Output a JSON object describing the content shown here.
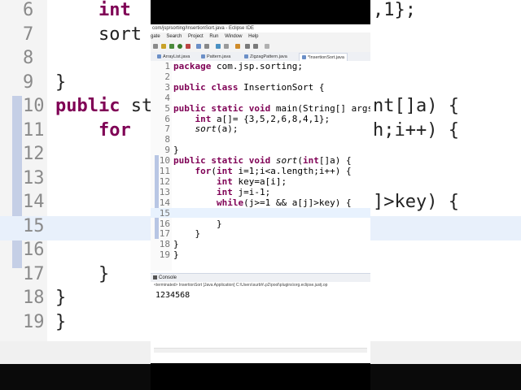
{
  "window": {
    "title": "com/jsp/sorting/InsertionSort.java - Eclipse IDE"
  },
  "menu": [
    "gate",
    "Search",
    "Project",
    "Run",
    "Window",
    "Help"
  ],
  "tabs": [
    {
      "label": "ArrayList.java",
      "active": false
    },
    {
      "label": "Pattern.java",
      "active": false
    },
    {
      "label": "ZigzagPattern.java",
      "active": false
    },
    {
      "label": "*InsertionSort.java",
      "active": true
    }
  ],
  "editor": {
    "lines": [
      {
        "n": "1",
        "code": "package com.jsp.sorting;"
      },
      {
        "n": "2",
        "code": ""
      },
      {
        "n": "3",
        "code": "public class InsertionSort {"
      },
      {
        "n": "4",
        "code": ""
      },
      {
        "n": "5",
        "code": "public static void main(String[] args"
      },
      {
        "n": "6",
        "code": "    int a[]= {3,5,2,6,8,4,1};"
      },
      {
        "n": "7",
        "code": "    sort(a);"
      },
      {
        "n": "8",
        "code": ""
      },
      {
        "n": "9",
        "code": "}"
      },
      {
        "n": "10",
        "code": "public static void sort(int[]a) {"
      },
      {
        "n": "11",
        "code": "    for(int i=1;i<a.length;i++) {"
      },
      {
        "n": "12",
        "code": "        int key=a[i];"
      },
      {
        "n": "13",
        "code": "        int j=i-1;"
      },
      {
        "n": "14",
        "code": "        while(j>=1 && a[j]>key) {"
      },
      {
        "n": "15",
        "code": ""
      },
      {
        "n": "16",
        "code": "        }"
      },
      {
        "n": "17",
        "code": "    }"
      },
      {
        "n": "18",
        "code": "}"
      },
      {
        "n": "19",
        "code": "}"
      }
    ]
  },
  "console": {
    "title": "Console",
    "launch": "<terminated> InsertionSort [Java Application] C:\\Users\\surbh\\.p2\\pool\\plugins\\org.eclipse.justj.op",
    "output": "1234568"
  },
  "background": {
    "lines": [
      {
        "n": "6",
        "code": "    int",
        "right": ",1};"
      },
      {
        "n": "7",
        "code": "    sort",
        "right": ""
      },
      {
        "n": "8",
        "code": "",
        "right": ""
      },
      {
        "n": "9",
        "code": "}",
        "right": ""
      },
      {
        "n": "10",
        "code": "public st",
        "right": "nt[]a) {"
      },
      {
        "n": "11",
        "code": "    for",
        "right": "h;i++) {"
      },
      {
        "n": "12",
        "code": "",
        "right": ""
      },
      {
        "n": "13",
        "code": "",
        "right": ""
      },
      {
        "n": "14",
        "code": "",
        "right": "]>key) {"
      },
      {
        "n": "15",
        "code": "",
        "right": ""
      },
      {
        "n": "16",
        "code": "",
        "right": ""
      },
      {
        "n": "17",
        "code": "    }",
        "right": ""
      },
      {
        "n": "18",
        "code": "}",
        "right": ""
      },
      {
        "n": "19",
        "code": "}",
        "right": ""
      }
    ]
  }
}
